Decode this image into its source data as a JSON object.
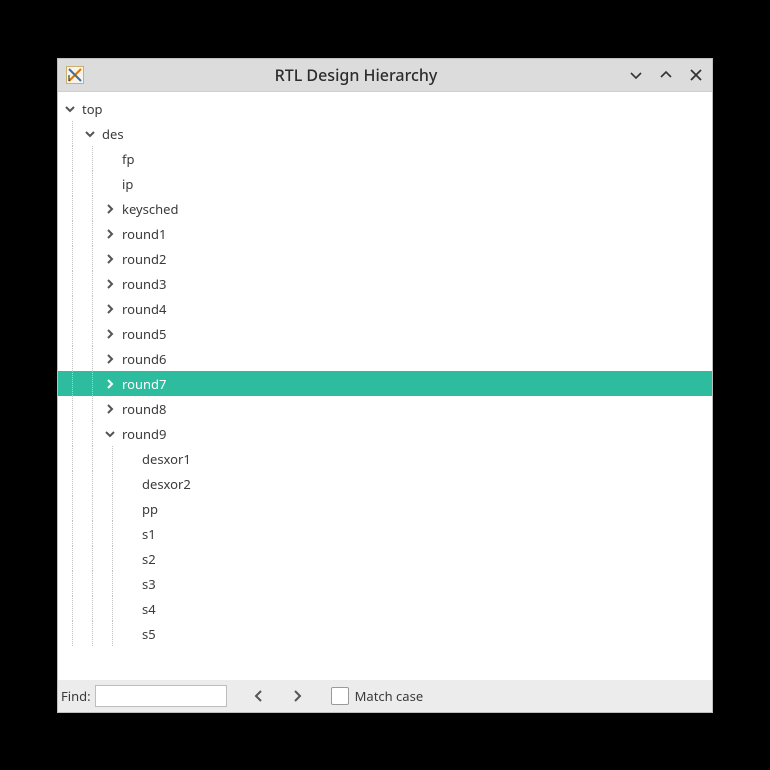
{
  "window": {
    "title": "RTL Design Hierarchy"
  },
  "tree": {
    "root": "top",
    "des": "des",
    "fp": "fp",
    "ip": "ip",
    "keysched": "keysched",
    "round1": "round1",
    "round2": "round2",
    "round3": "round3",
    "round4": "round4",
    "round5": "round5",
    "round6": "round6",
    "round7": "round7",
    "round8": "round8",
    "round9": "round9",
    "desxor1": "desxor1",
    "desxor2": "desxor2",
    "pp": "pp",
    "s1": "s1",
    "s2": "s2",
    "s3": "s3",
    "s4": "s4",
    "s5": "s5"
  },
  "findbar": {
    "label": "Find:",
    "value": "",
    "match_case": "Match case"
  }
}
